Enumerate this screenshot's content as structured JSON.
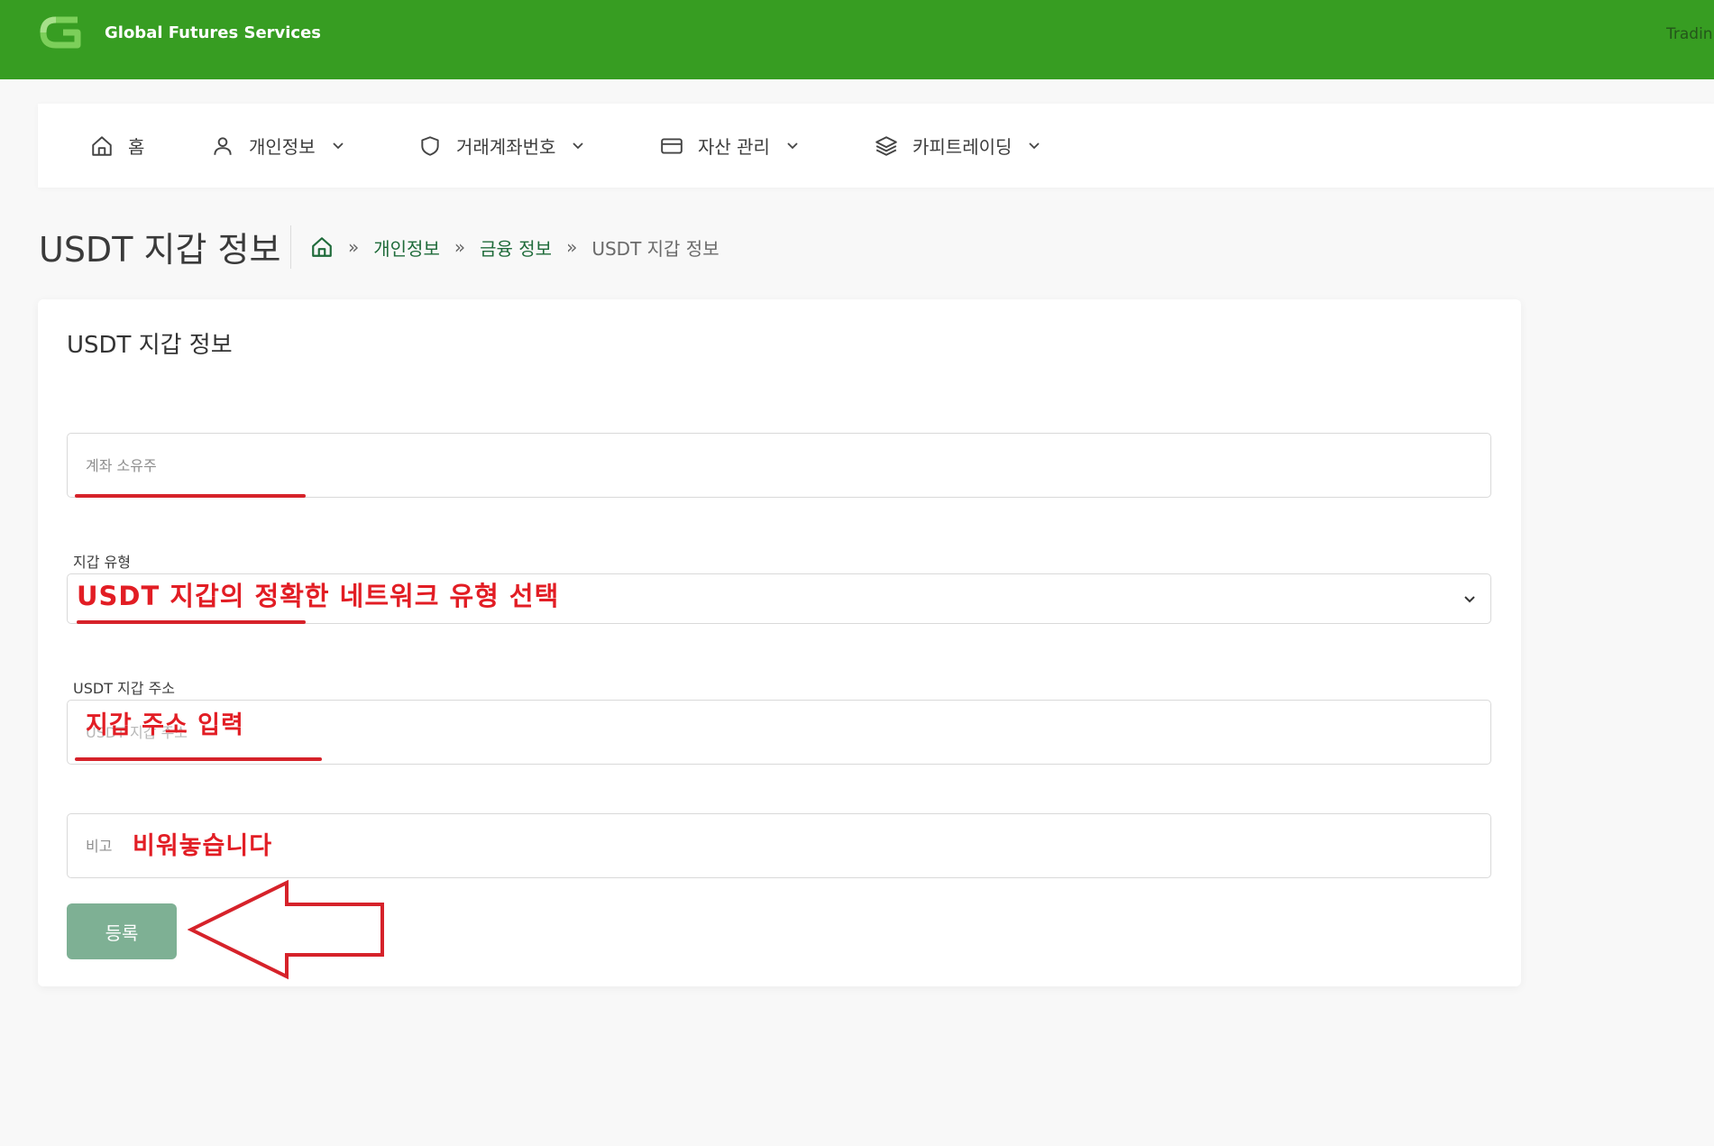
{
  "header": {
    "brand": "Global Futures Services",
    "right_label": "Tradin"
  },
  "nav": {
    "items": [
      {
        "label": "홈",
        "icon": "home-icon"
      },
      {
        "label": "개인정보",
        "icon": "user-icon"
      },
      {
        "label": "거래계좌번호",
        "icon": "shield-icon"
      },
      {
        "label": "자산 관리",
        "icon": "credit-card-icon"
      },
      {
        "label": "카피트레이딩",
        "icon": "layers-icon"
      }
    ]
  },
  "page": {
    "title": "USDT 지갑 정보",
    "breadcrumb": {
      "sep": "»",
      "items": [
        "개인정보",
        "금융 정보"
      ],
      "current": "USDT 지갑 정보"
    }
  },
  "form": {
    "title": "USDT 지갑 정보",
    "account_owner": {
      "placeholder": "계좌 소유주"
    },
    "wallet_type": {
      "label": "지갑 유형",
      "annotation": "USDT 지갑의 정확한 네트워크 유형 선택"
    },
    "wallet_address": {
      "label": "USDT 지갑 주소",
      "placeholder": "USDT 지갑 주소",
      "annotation": "지갑 주소 입력"
    },
    "note": {
      "placeholder": "비고",
      "annotation": "비워놓습니다"
    },
    "submit_label": "등록"
  },
  "colors": {
    "header_bg": "#379d22",
    "accent_link": "#1f6b3a",
    "submit_bg": "#7eb094",
    "annotation_red": "#e21d24"
  }
}
